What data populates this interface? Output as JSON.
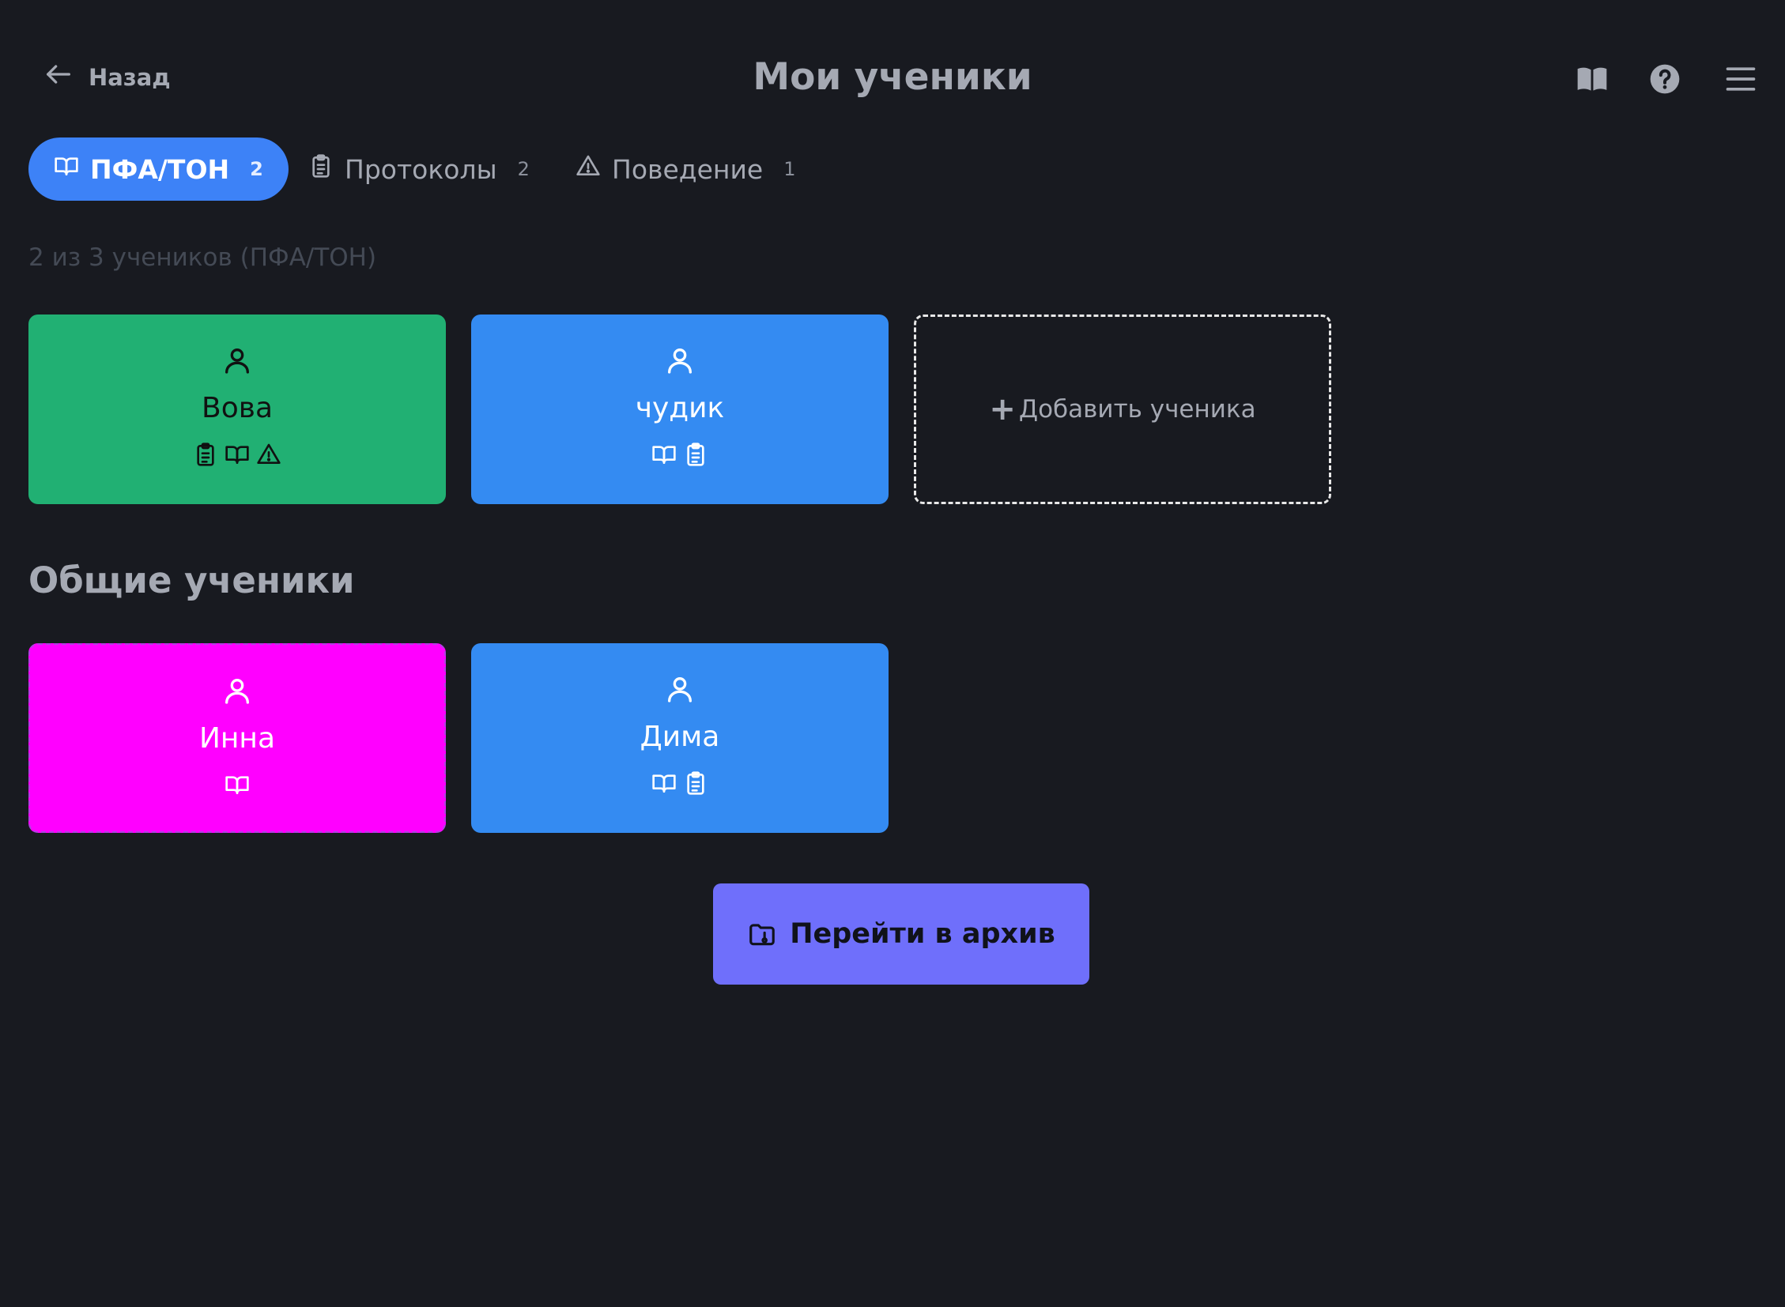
{
  "header": {
    "back_label": "Назад",
    "title": "Мои ученики",
    "icons": [
      "book-icon",
      "help-icon",
      "menu-icon"
    ]
  },
  "tabs": [
    {
      "label": "ПФА/ТОН",
      "count": "2",
      "icon": "book-open-icon",
      "active": true
    },
    {
      "label": "Протоколы",
      "count": "2",
      "icon": "clipboard-icon",
      "active": false
    },
    {
      "label": "Поведение",
      "count": "1",
      "icon": "warning-icon",
      "active": false
    }
  ],
  "summary": "2 из 3 учеников (ПФА/ТОН)",
  "my_students": [
    {
      "name": "Вова",
      "color": "#21b073",
      "badges": [
        "clipboard-icon",
        "book-open-icon",
        "warning-icon"
      ]
    },
    {
      "name": "чудик",
      "color": "#348bf2",
      "badges": [
        "book-open-icon",
        "clipboard-icon"
      ]
    }
  ],
  "add_student_label": "Добавить ученика",
  "shared_section_title": "Общие ученики",
  "shared_students": [
    {
      "name": "Инна",
      "color": "#ff00ff",
      "badges": [
        "book-open-icon"
      ]
    },
    {
      "name": "Дима",
      "color": "#348bf2",
      "badges": [
        "book-open-icon",
        "clipboard-icon"
      ]
    }
  ],
  "archive_button_label": "Перейти в архив"
}
